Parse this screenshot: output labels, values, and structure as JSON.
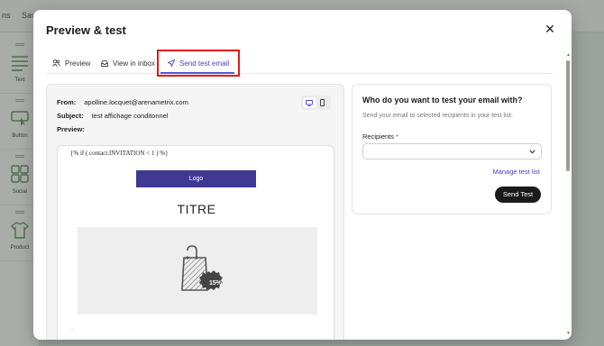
{
  "background": {
    "topbar_items": [
      "ns",
      "Sav"
    ],
    "sidebar_blocks": [
      {
        "label": "Text",
        "icon": "text-lines-icon"
      },
      {
        "label": "Button",
        "icon": "button-cursor-icon"
      },
      {
        "label": "Social",
        "icon": "social-grid-icon"
      },
      {
        "label": "Product",
        "icon": "tshirt-icon"
      }
    ]
  },
  "modal": {
    "title": "Preview & test",
    "close_icon": "close-icon",
    "tabs": [
      {
        "label": "Preview",
        "icon": "users-icon"
      },
      {
        "label": "View in inbox",
        "icon": "inbox-icon"
      },
      {
        "label": "Send test email",
        "icon": "send-plane-icon",
        "active": true
      }
    ],
    "accent_color": "#4a3fbf",
    "highlight_color": "#e11818"
  },
  "preview": {
    "from_label": "From:",
    "from_value": "apolline.locquet@arenametrix.com",
    "subject_label": "Subject:",
    "subject_value": "test affichage conditonnel",
    "preview_label": "Preview:",
    "device_toggle": {
      "desktop_icon": "desktop-icon",
      "mobile_icon": "mobile-icon",
      "selected": "desktop"
    },
    "email": {
      "condition_text": "{% if ( contact.INVITATION < 1 ) %}",
      "logo_label": "Logo",
      "heading": "TITRE",
      "image_icon": "shopping-bag-icon",
      "badge_text": "15%",
      "footer_text": "..."
    }
  },
  "test_panel": {
    "title": "Who do you want to test your email with?",
    "subtitle": "Send your email to selected recipients in your test list.",
    "recipients_label": "Recipients",
    "required_mark": "*",
    "select_value": "",
    "manage_link": "Manage test list",
    "send_button": "Send Test"
  }
}
